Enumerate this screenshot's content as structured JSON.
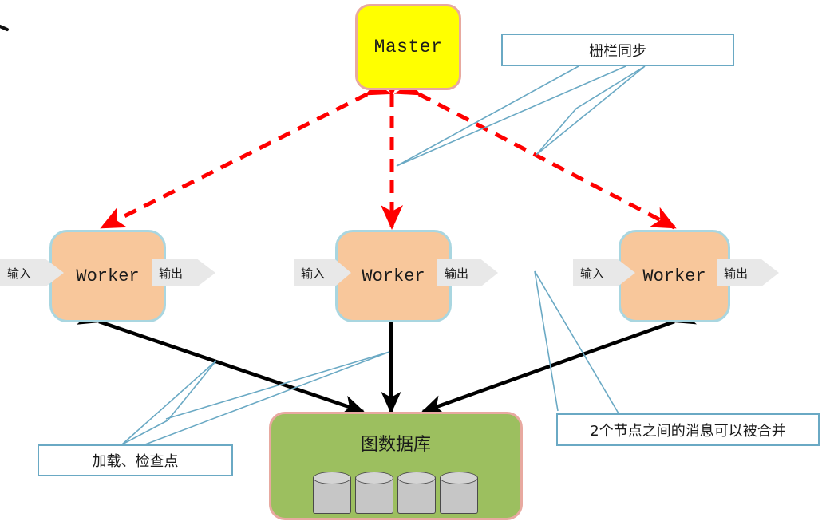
{
  "diagram": {
    "title": "Graph processing master-worker architecture",
    "colors": {
      "master_fill": "#ffff00",
      "master_border": "#e8a9a0",
      "worker_fill": "#f8c79b",
      "worker_border": "#a9d6e0",
      "db_fill": "#9cbf5f",
      "db_border": "#e8a9a0",
      "sync_arrow": "#ff0000",
      "data_arrow": "#000000",
      "callout_border": "#6aa9c4",
      "cylinder_fill": "#c6c6c6"
    }
  },
  "master": {
    "label": "Master"
  },
  "workers": [
    {
      "label": "Worker",
      "input": "输入",
      "output": "输出"
    },
    {
      "label": "Worker",
      "input": "输入",
      "output": "输出"
    },
    {
      "label": "Worker",
      "input": "输入",
      "output": "输出"
    }
  ],
  "database": {
    "label": "图数据库",
    "cylinder_count": 4
  },
  "notes": {
    "fence_sync": "栅栏同步",
    "load_checkpoint": "加载、检查点",
    "message_merge": "2个节点之间的消息可以被合并"
  }
}
